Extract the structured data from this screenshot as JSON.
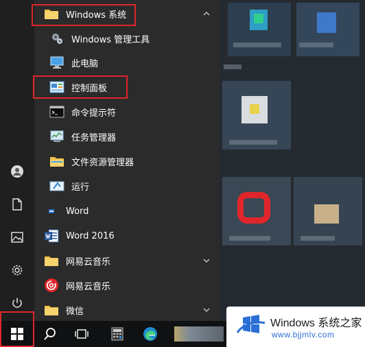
{
  "rail": {
    "items": [
      {
        "name": "user-avatar-icon"
      },
      {
        "name": "document-icon"
      },
      {
        "name": "pictures-icon"
      },
      {
        "name": "settings-gear-icon"
      },
      {
        "name": "power-icon"
      }
    ]
  },
  "start_list": {
    "items": [
      {
        "label": "Windows 系统",
        "icon": "folder-icon",
        "type": "folder",
        "expanded": true
      },
      {
        "label": "Windows 管理工具",
        "icon": "gear-tools-icon",
        "type": "app"
      },
      {
        "label": "此电脑",
        "icon": "computer-icon",
        "type": "app"
      },
      {
        "label": "控制面板",
        "icon": "control-panel-icon",
        "type": "app"
      },
      {
        "label": "命令提示符",
        "icon": "command-prompt-icon",
        "type": "app"
      },
      {
        "label": "任务管理器",
        "icon": "task-manager-icon",
        "type": "app"
      },
      {
        "label": "文件资源管理器",
        "icon": "folder-icon",
        "type": "app"
      },
      {
        "label": "运行",
        "icon": "run-icon",
        "type": "app"
      },
      {
        "label": "Word",
        "icon": "word-small-icon",
        "type": "app"
      },
      {
        "label": "Word 2016",
        "icon": "word-icon",
        "type": "app"
      },
      {
        "label": "网易云音乐",
        "icon": "folder-icon",
        "type": "folder",
        "expanded": false
      },
      {
        "label": "网易云音乐",
        "icon": "netease-music-icon",
        "type": "app"
      },
      {
        "label": "微信",
        "icon": "folder-icon",
        "type": "folder",
        "expanded": false
      }
    ]
  },
  "taskbar": {
    "buttons": [
      {
        "name": "start-windows-icon"
      },
      {
        "name": "search-icon"
      },
      {
        "name": "task-view-icon"
      },
      {
        "name": "calculator-icon"
      },
      {
        "name": "edge-icon"
      }
    ]
  },
  "watermark": {
    "title": "Windows 系统之家",
    "url": "www.bjjmlv.com"
  },
  "colors": {
    "highlight": "#e0262b",
    "folder": "#f2c24a",
    "accent": "#2a6fd6"
  }
}
